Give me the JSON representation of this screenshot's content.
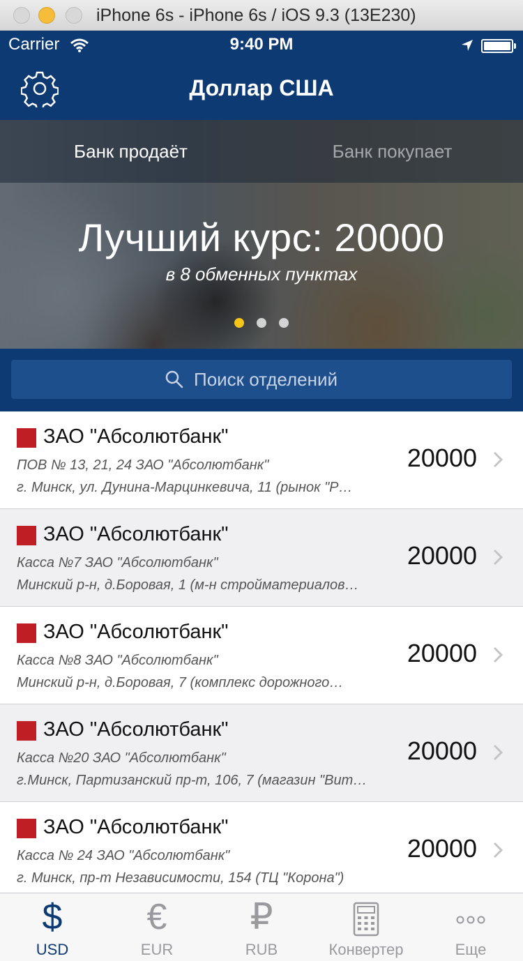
{
  "window": {
    "title": "iPhone 6s - iPhone 6s / iOS 9.3 (13E230)"
  },
  "status_bar": {
    "carrier": "Carrier",
    "time": "9:40 PM"
  },
  "nav": {
    "title": "Доллар США"
  },
  "hero": {
    "tabs": [
      {
        "label": "Банк продаёт",
        "active": true
      },
      {
        "label": "Банк покупает",
        "active": false
      }
    ],
    "best_rate": "Лучший курс: 20000",
    "subtitle": "в 8 обменных пунктах",
    "page_count": 3,
    "active_page": 1
  },
  "search": {
    "placeholder": "Поиск отделений"
  },
  "list": {
    "rows": [
      {
        "bank": "ЗАО \"Абсолютбанк\"",
        "branch": "ПОВ № 13, 21, 24 ЗАО \"Абсолютбанк\"",
        "address": "г. Минск, ул. Дунина-Марцинкевича, 11 (рынок \"Р…",
        "rate": "20000"
      },
      {
        "bank": "ЗАО \"Абсолютбанк\"",
        "branch": "Касса №7 ЗАО \"Абсолютбанк\"",
        "address": "Минский р-н, д.Боровая, 1 (м-н стройматериалов…",
        "rate": "20000"
      },
      {
        "bank": "ЗАО \"Абсолютбанк\"",
        "branch": "Касса №8 ЗАО \"Абсолютбанк\"",
        "address": "Минский р-н, д.Боровая, 7 (комплекс дорожного…",
        "rate": "20000"
      },
      {
        "bank": "ЗАО \"Абсолютбанк\"",
        "branch": "Касса №20 ЗАО \"Абсолютбанк\"",
        "address": "г.Минск, Партизанский пр-т, 106, 7 (магазин \"Вит…",
        "rate": "20000"
      },
      {
        "bank": "ЗАО \"Абсолютбанк\"",
        "branch": "Касса № 24  ЗАО \"Абсолютбанк\"",
        "address": "г. Минск, пр-т Независимости, 154 (ТЦ \"Корона\")",
        "rate": "20000"
      }
    ]
  },
  "tab_bar": {
    "items": [
      {
        "label": "USD",
        "glyph": "$",
        "icon": "dollar-icon",
        "active": true
      },
      {
        "label": "EUR",
        "glyph": "€",
        "icon": "euro-icon",
        "active": false
      },
      {
        "label": "RUB",
        "glyph": "₽",
        "icon": "ruble-icon",
        "active": false
      },
      {
        "label": "Конвертер",
        "glyph": "",
        "icon": "calculator-icon",
        "active": false
      },
      {
        "label": "Еще",
        "glyph": "",
        "icon": "more-icon",
        "active": false
      }
    ]
  },
  "colors": {
    "brand_blue": "#0e3a73",
    "search_blue": "#1d4f8c",
    "bank_red": "#bf1e24",
    "page_dot_active": "#f5c518"
  }
}
